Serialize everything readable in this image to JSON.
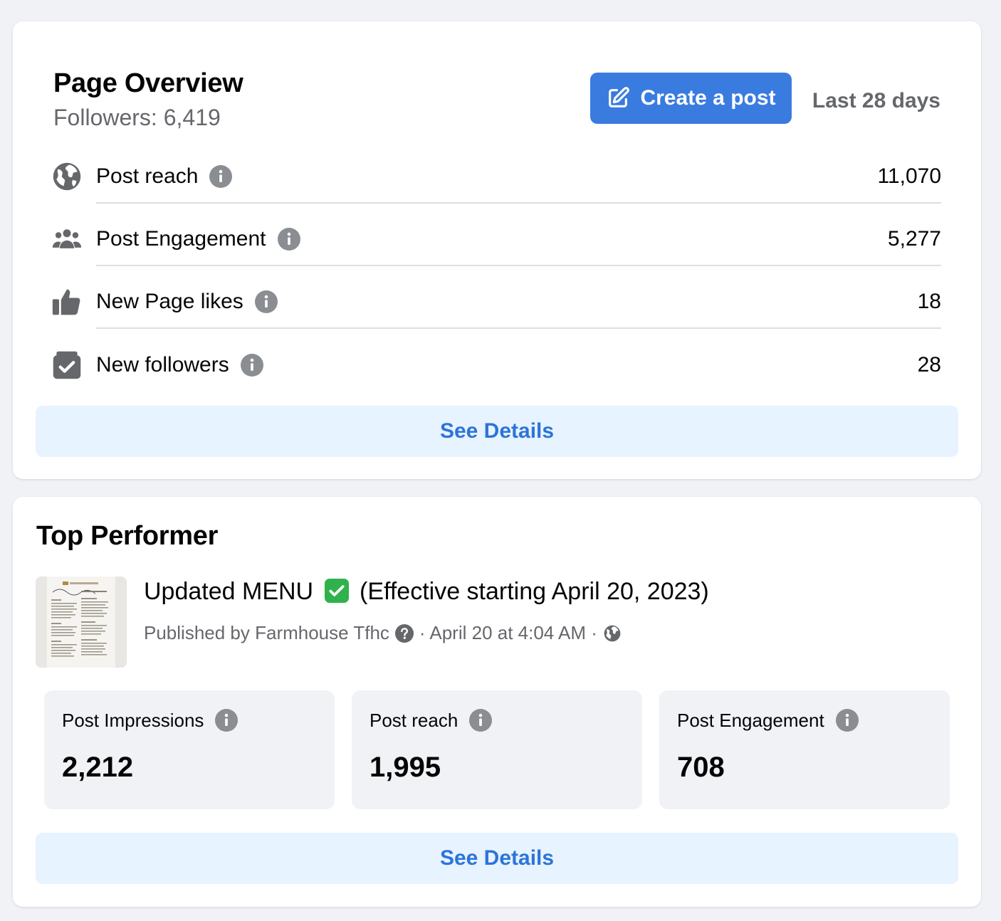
{
  "overview": {
    "title": "Page Overview",
    "followers": "Followers: 6,419",
    "create_label": "Create a post",
    "range": "Last 28 days",
    "metrics": [
      {
        "icon": "globe-icon",
        "label": "Post reach",
        "value": "11,070"
      },
      {
        "icon": "people-icon",
        "label": "Post Engagement",
        "value": "5,277"
      },
      {
        "icon": "thumbs-up-icon",
        "label": "New Page likes",
        "value": "18"
      },
      {
        "icon": "follow-check-icon",
        "label": "New followers",
        "value": "28"
      }
    ],
    "see_details": "See Details"
  },
  "top_performer": {
    "title": "Top Performer",
    "post_title_a": "Updated MENU",
    "post_title_b": "(Effective starting April 20, 2023)",
    "published_by": "Published by Farmhouse Tfhc",
    "date": "· April 20 at 4:04 AM ·",
    "stats": [
      {
        "label": "Post Impressions",
        "value": "2,212"
      },
      {
        "label": "Post reach",
        "value": "1,995"
      },
      {
        "label": "Post Engagement",
        "value": "708"
      }
    ],
    "see_details": "See Details"
  },
  "colors": {
    "accent": "#3a7be0",
    "link": "#2c74d9",
    "secondary_text": "#65676b",
    "check_green": "#2fb24c"
  }
}
